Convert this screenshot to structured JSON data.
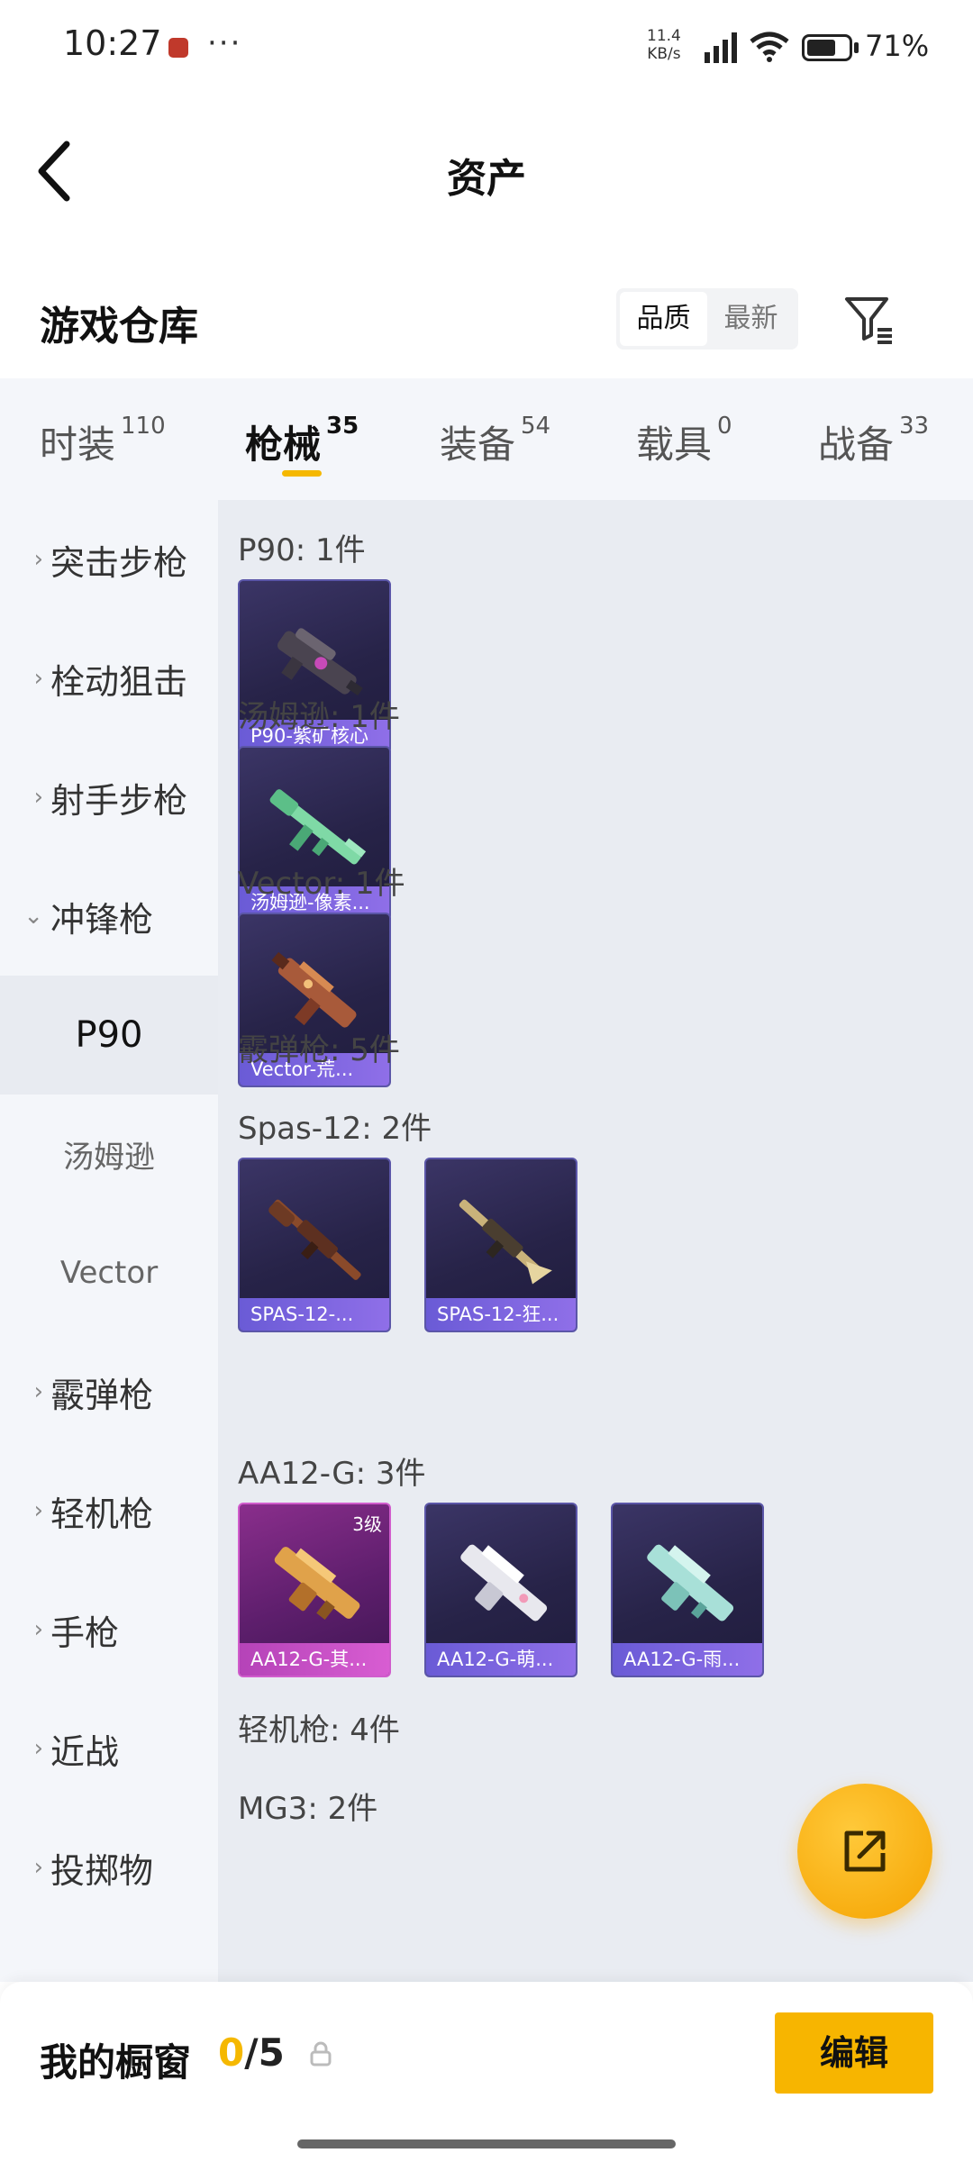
{
  "status_bar": {
    "time": "10:27",
    "more": "···",
    "net_speed": "11.4",
    "net_unit": "KB/s",
    "network": "5G",
    "battery": "71%",
    "battery_level": 0.71
  },
  "header": {
    "title": "资产"
  },
  "warehouse": {
    "title": "游戏仓库",
    "sort_options": [
      "品质",
      "最新"
    ]
  },
  "category_tabs": [
    {
      "label": "时装",
      "count": "110"
    },
    {
      "label": "枪械",
      "count": "35",
      "active": true
    },
    {
      "label": "装备",
      "count": "54"
    },
    {
      "label": "载具",
      "count": "0"
    },
    {
      "label": "战备",
      "count": "33"
    }
  ],
  "sidebar": {
    "items": [
      {
        "label": "突击步枪",
        "chevron": "›"
      },
      {
        "label": "栓动狙击",
        "chevron": "›"
      },
      {
        "label": "射手步枪",
        "chevron": "›"
      },
      {
        "label": "冲锋枪",
        "chevron": "⌄"
      },
      {
        "label": "霰弹枪",
        "chevron": "›"
      },
      {
        "label": "轻机枪",
        "chevron": "›"
      },
      {
        "label": "手枪",
        "chevron": "›"
      },
      {
        "label": "近战",
        "chevron": "›"
      },
      {
        "label": "投掷物",
        "chevron": "›"
      }
    ],
    "sub_items": [
      "P90",
      "汤姆逊",
      "Vector"
    ]
  },
  "groups": {
    "p90": {
      "title": "P90: 1件",
      "cards": [
        "P90-紫矿核心"
      ]
    },
    "thompson": {
      "title": "汤姆逊: 1件",
      "cards": [
        "汤姆逊-像素..."
      ]
    },
    "vector": {
      "title": "Vector: 1件",
      "cards": [
        "Vector-荒..."
      ]
    },
    "shotgun": {
      "title": "霰弹枪: 5件"
    },
    "spas": {
      "title": "Spas-12: 2件",
      "cards": [
        "SPAS-12-...",
        "SPAS-12-狂..."
      ]
    },
    "aa12": {
      "title": "AA12-G: 3件",
      "cards": [
        "AA12-G-其...",
        "AA12-G-萌...",
        "AA12-G-雨..."
      ],
      "level": "3级"
    },
    "lmg": {
      "title": "轻机枪: 4件"
    },
    "mg3": {
      "title": "MG3: 2件"
    }
  },
  "bottom_bar": {
    "title": "我的橱窗",
    "current": "0",
    "total": "/5",
    "edit_label": "编辑"
  },
  "colors": {
    "accent": "#f5b800",
    "card_purple": "#2a2550",
    "card_pink": "#6d2278",
    "label_purple": "#7a66e0"
  },
  "icons": [
    "back-arrow-icon",
    "filter-icon",
    "lock-icon",
    "share-icon",
    "signal-icon",
    "wifi-icon",
    "battery-icon"
  ]
}
